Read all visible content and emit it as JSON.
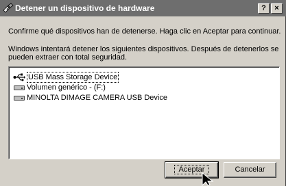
{
  "window": {
    "title": "Detener un dispositivo de hardware",
    "help_label": "?",
    "close_label": "×"
  },
  "content": {
    "prompt": "Confirme qué dispositivos han de detenerse. Haga clic en Aceptar para continuar.",
    "info": "Windows intentará detener los siguientes dispositivos. Después de detenerlos se pueden extraer con total seguridad."
  },
  "devices": [
    {
      "label": "USB Mass Storage Device",
      "icon": "usb-icon"
    },
    {
      "label": "Volumen genérico - (F:)",
      "icon": "drive-icon"
    },
    {
      "label": "MINOLTA DIMAGE CAMERA USB Device",
      "icon": "drive-icon"
    }
  ],
  "buttons": {
    "ok": "Aceptar",
    "cancel": "Cancelar"
  },
  "colors": {
    "face": "#d4d0c8",
    "titlebar": "#6e6e6e",
    "list_bg": "#ffffff"
  }
}
